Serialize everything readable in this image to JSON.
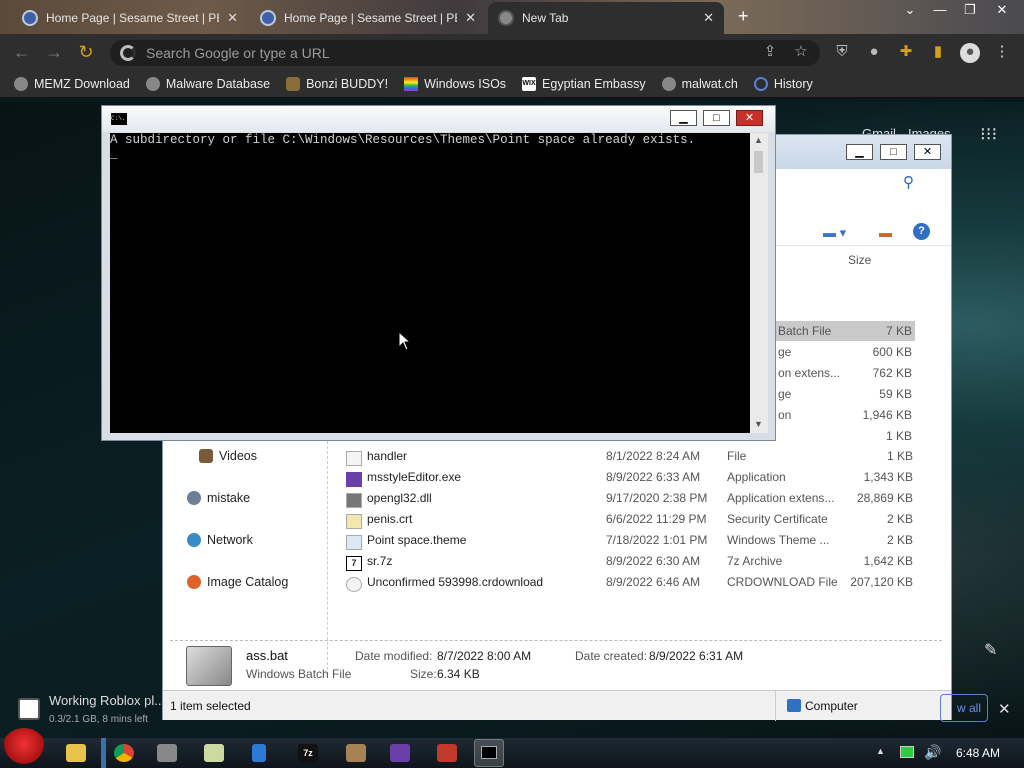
{
  "browser": {
    "tabs": [
      {
        "title": "Home Page | Sesame Street | PB",
        "close": "✕"
      },
      {
        "title": "Home Page | Sesame Street | PB",
        "close": "✕"
      },
      {
        "title": "New Tab",
        "close": "✕"
      }
    ],
    "new_tab": "+",
    "omnibox_placeholder": "Search Google or type a URL",
    "bookmarks": [
      "MEMZ Download",
      "Malware Database",
      "Bonzi BUDDY!",
      "Windows ISOs",
      "Egyptian Embassy",
      "malwat.ch",
      "History"
    ],
    "ntp_links": [
      "Gmail",
      "Images"
    ]
  },
  "cmd": {
    "icon_label": "C:\\.",
    "line": "A subdirectory or file C:\\Windows\\Resources\\Themes\\Point space already exists.",
    "cursor": "_"
  },
  "explorer": {
    "column_size": "Size",
    "partial_rows": [
      {
        "type": "Batch File",
        "size": "7 KB"
      },
      {
        "type": "ge",
        "size": "600 KB"
      },
      {
        "type": "on extens...",
        "size": "762 KB"
      },
      {
        "type": "ge",
        "size": "59 KB"
      },
      {
        "type": "on",
        "size": "1,946 KB"
      },
      {
        "type": "",
        "size": "1 KB"
      }
    ],
    "files": [
      {
        "name": "handler",
        "date": "8/1/2022 8:24 AM",
        "type": "File",
        "size": "1 KB"
      },
      {
        "name": "msstyleEditor.exe",
        "date": "8/9/2022 6:33 AM",
        "type": "Application",
        "size": "1,343 KB"
      },
      {
        "name": "opengl32.dll",
        "date": "9/17/2020 2:38 PM",
        "type": "Application extens...",
        "size": "28,869 KB"
      },
      {
        "name": "penis.crt",
        "date": "6/6/2022 11:29 PM",
        "type": "Security Certificate",
        "size": "2 KB"
      },
      {
        "name": "Point space.theme",
        "date": "7/18/2022 1:01 PM",
        "type": "Windows Theme ...",
        "size": "2 KB"
      },
      {
        "name": "sr.7z",
        "date": "8/9/2022 6:30 AM",
        "type": "7z Archive",
        "size": "1,642 KB"
      },
      {
        "name": "Unconfirmed 593998.crdownload",
        "date": "8/9/2022 6:46 AM",
        "type": "CRDOWNLOAD File",
        "size": "207,120 KB"
      }
    ],
    "nav": [
      "Videos",
      "mistake",
      "Network",
      "Image Catalog"
    ],
    "details": {
      "name": "ass.bat",
      "kind": "Windows Batch File",
      "modified_label": "Date modified:",
      "modified": "8/7/2022 8:00 AM",
      "created_label": "Date created:",
      "created": "8/9/2022 6:31 AM",
      "size_label": "Size:",
      "size": "6.34 KB"
    },
    "status": "1 item selected",
    "status_location": "Computer"
  },
  "download": {
    "title": "Working Roblox pl...",
    "progress": "0.3/2.1 GB, 8 mins left",
    "show_all": "w all"
  },
  "taskbar": {
    "clock": "6:48 AM",
    "tray_arrow": "▲"
  }
}
